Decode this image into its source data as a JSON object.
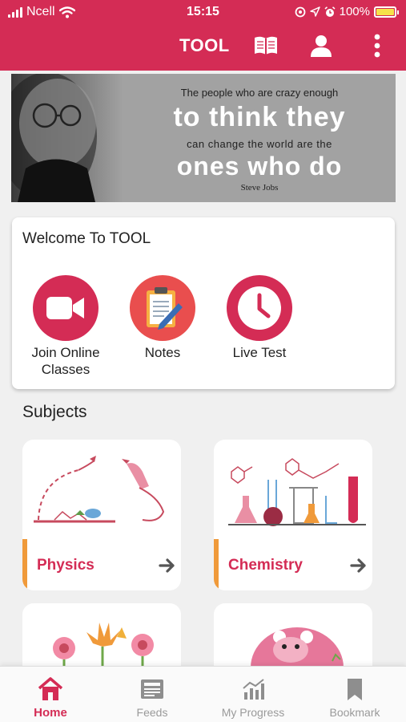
{
  "status_bar": {
    "carrier": "Ncell",
    "time": "15:15",
    "battery_percent": "100%",
    "battery_level": 1.0
  },
  "header": {
    "title": "TOOL",
    "icons": [
      "book-icon",
      "user-icon",
      "more-vertical-icon"
    ],
    "background": "#d42c55"
  },
  "banner": {
    "line1": "The people who are crazy enough",
    "line2": "to think they",
    "line3": "can change the world are the",
    "line4": "ones who do",
    "author": "Steve Jobs"
  },
  "welcome": {
    "title": "Welcome To TOOL",
    "actions": [
      {
        "label": "Join Online Classes",
        "icon": "video-camera-icon",
        "color": "#d42c55"
      },
      {
        "label": "Notes",
        "icon": "notepad-pencil-icon",
        "color": "#e94e4e"
      },
      {
        "label": "Live Test",
        "icon": "clock-icon",
        "color": "#d42c55"
      }
    ]
  },
  "subjects": {
    "title": "Subjects",
    "items": [
      {
        "name": "Physics",
        "icon": "rocket-illustration"
      },
      {
        "name": "Chemistry",
        "icon": "lab-flasks-illustration"
      },
      {
        "name": "",
        "icon": "flowers-illustration"
      },
      {
        "name": "",
        "icon": "panda-illustration"
      }
    ],
    "accent_color": "#f09a3a"
  },
  "bottom_nav": {
    "items": [
      {
        "label": "Home",
        "icon": "home-icon",
        "active": true
      },
      {
        "label": "Feeds",
        "icon": "newspaper-icon",
        "active": false
      },
      {
        "label": "My Progress",
        "icon": "chart-icon",
        "active": false
      },
      {
        "label": "Bookmark",
        "icon": "bookmark-icon",
        "active": false
      }
    ]
  }
}
